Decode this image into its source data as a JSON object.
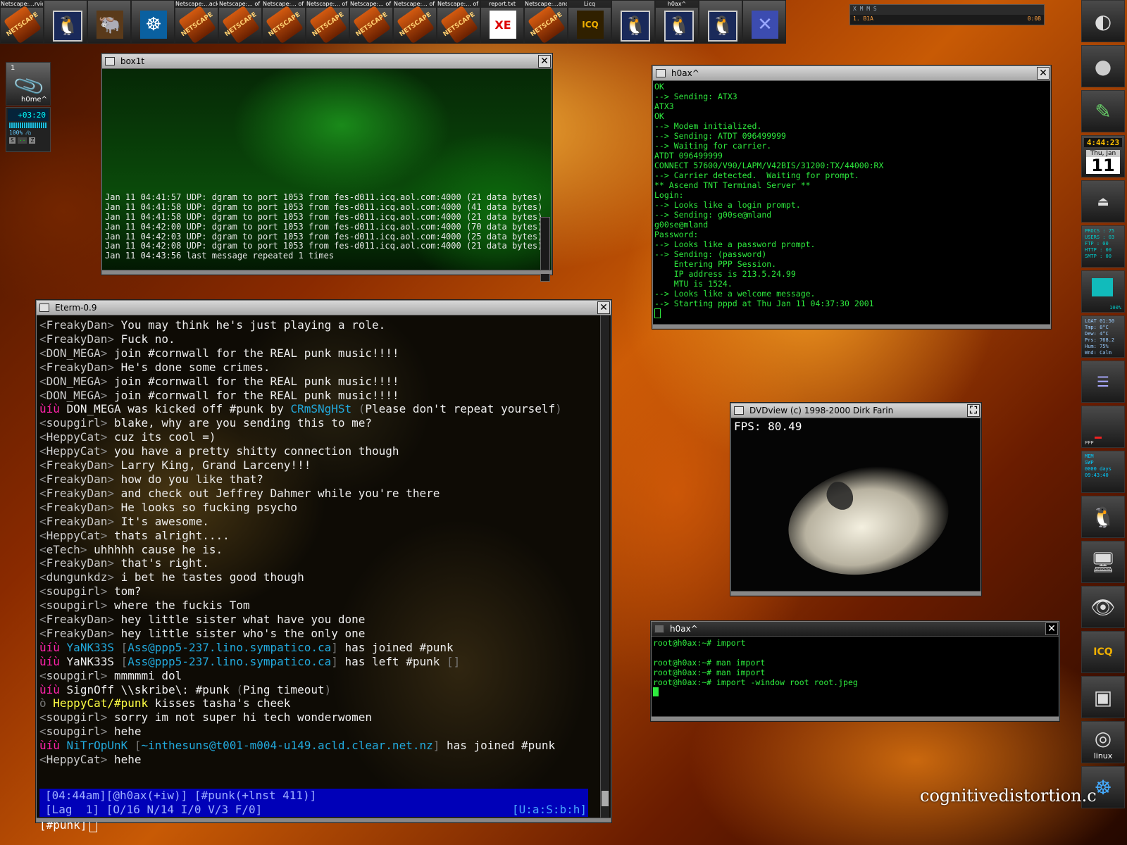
{
  "taskbar": {
    "items": [
      {
        "label": "Netscape:...rvice",
        "icon": "netscape-icon",
        "glyph": "NETSCAPE"
      },
      {
        "label": "",
        "icon": "tux-monitor-icon",
        "glyph": "🐧"
      },
      {
        "label": "",
        "icon": "gnu-icon",
        "glyph": "🐃"
      },
      {
        "label": "",
        "icon": "netscape-wheel-icon",
        "glyph": "☸"
      },
      {
        "label": "Netscape:...acks",
        "icon": "netscape-icon",
        "glyph": "NETSCAPE"
      },
      {
        "label": "Netscape:... of 7",
        "icon": "netscape-icon",
        "glyph": "NETSCAPE"
      },
      {
        "label": "Netscape:... of 7",
        "icon": "netscape-icon",
        "glyph": "NETSCAPE"
      },
      {
        "label": "Netscape:... of 7",
        "icon": "netscape-icon",
        "glyph": "NETSCAPE"
      },
      {
        "label": "Netscape:... of 7",
        "icon": "netscape-icon",
        "glyph": "NETSCAPE"
      },
      {
        "label": "Netscape:... of 7",
        "icon": "netscape-icon",
        "glyph": "NETSCAPE"
      },
      {
        "label": "Netscape:... of 7",
        "icon": "netscape-icon",
        "glyph": "NETSCAPE"
      },
      {
        "label": "report.txt",
        "icon": "xedit-icon",
        "glyph": "XE"
      },
      {
        "label": "Netscape:...ands",
        "icon": "netscape-icon",
        "glyph": "NETSCAPE"
      },
      {
        "label": "Licq",
        "icon": "icq-icon",
        "glyph": "ICQ"
      },
      {
        "label": "",
        "icon": "tux-monitor-icon",
        "glyph": "🐧"
      },
      {
        "label": "h0ax^",
        "icon": "tux-monitor-icon",
        "glyph": "🐧"
      },
      {
        "label": "",
        "icon": "tux-monitor-icon",
        "glyph": "🐧"
      },
      {
        "label": "",
        "icon": "xmms-x-icon",
        "glyph": "✕"
      }
    ]
  },
  "xmms": {
    "title": "X M M S",
    "track": "1. B1A",
    "time": "0:08"
  },
  "left_widgets": {
    "desk_number": "1",
    "desk_label": "h0me^",
    "timer": "+03:20",
    "percent": "100% ⁄⁄⌂"
  },
  "box1t": {
    "title": "box1t",
    "lines": [
      "Jan 11 04:41:57 UDP: dgram to port 1053 from fes-d011.icq.aol.com:4000 (21 data bytes)",
      "Jan 11 04:41:58 UDP: dgram to port 1053 from fes-d011.icq.aol.com:4000 (41 data bytes)",
      "Jan 11 04:41:58 UDP: dgram to port 1053 from fes-d011.icq.aol.com:4000 (21 data bytes)",
      "Jan 11 04:42:00 UDP: dgram to port 1053 from fes-d011.icq.aol.com:4000 (70 data bytes)",
      "Jan 11 04:42:03 UDP: dgram to port 1053 from fes-d011.icq.aol.com:4000 (25 data bytes)",
      "Jan 11 04:42:08 UDP: dgram to port 1053 from fes-d011.icq.aol.com:4000 (21 data bytes)",
      "Jan 11 04:43:56 last message repeated 1 times"
    ]
  },
  "h0ax_top": {
    "title": "h0ax^",
    "lines": [
      "OK",
      "--> Sending: ATX3",
      "ATX3",
      "OK",
      "--> Modem initialized.",
      "--> Sending: ATDT 096499999",
      "--> Waiting for carrier.",
      "ATDT 096499999",
      "CONNECT 57600/V90/LAPM/V42BIS/31200:TX/44000:RX",
      "--> Carrier detected.  Waiting for prompt.",
      "** Ascend TNT Terminal Server **",
      "Login:",
      "--> Looks like a login prompt.",
      "--> Sending: g00se@mland",
      "g00se@mland",
      "Password:",
      "--> Looks like a password prompt.",
      "--> Sending: (password)",
      "    Entering PPP Session.",
      "    IP address is 213.5.24.99",
      "    MTU is 1524.",
      "--> Looks like a welcome message.",
      "--> Starting pppd at Thu Jan 11 04:37:30 2001"
    ]
  },
  "eterm": {
    "title": "Eterm-0.9",
    "lines": [
      {
        "t": "msg",
        "nick": "FreakyDan",
        "text": "You may think he's just playing a role."
      },
      {
        "t": "msg",
        "nick": "FreakyDan",
        "text": "Fuck no."
      },
      {
        "t": "msg",
        "nick": "DON_MEGA",
        "text": "join #cornwall for the REAL punk music!!!!"
      },
      {
        "t": "msg",
        "nick": "FreakyDan",
        "text": "He's done some crimes."
      },
      {
        "t": "msg",
        "nick": "DON_MEGA",
        "text": "join #cornwall for the REAL punk music!!!!"
      },
      {
        "t": "msg",
        "nick": "DON_MEGA",
        "text": "join #cornwall for the REAL punk music!!!!"
      },
      {
        "t": "kick",
        "prefix": "ùíù",
        "a": "DON_MEGA was kicked off #punk by ",
        "b": "CRmSNgHSt",
        "c": "Please don't repeat yourself"
      },
      {
        "t": "msg",
        "nick": "soupgirl",
        "text": "blake, why are you sending this to me?"
      },
      {
        "t": "msg",
        "nick": "HeppyCat",
        "text": "cuz its cool =)"
      },
      {
        "t": "msg",
        "nick": "HeppyCat",
        "text": "you have a pretty shitty connection though"
      },
      {
        "t": "msg",
        "nick": "FreakyDan",
        "text": "Larry King, Grand Larceny!!!"
      },
      {
        "t": "msg",
        "nick": "FreakyDan",
        "text": "how do you like that?"
      },
      {
        "t": "msg",
        "nick": "FreakyDan",
        "text": "and check out Jeffrey Dahmer while you're there"
      },
      {
        "t": "msg",
        "nick": "FreakyDan",
        "text": "He looks so fucking psycho"
      },
      {
        "t": "msg",
        "nick": "FreakyDan",
        "text": "It's awesome."
      },
      {
        "t": "msg",
        "nick": "HeppyCat",
        "text": "thats alright...."
      },
      {
        "t": "msg",
        "nick": "eTech",
        "text": "uhhhhh cause he is."
      },
      {
        "t": "msg",
        "nick": "FreakyDan",
        "text": "that's right."
      },
      {
        "t": "msg",
        "nick": "dungunkdz",
        "text": "i bet he tastes good though"
      },
      {
        "t": "msg",
        "nick": "soupgirl",
        "text": "tom?"
      },
      {
        "t": "msg",
        "nick": "soupgirl",
        "text": "where the fuckis Tom"
      },
      {
        "t": "msg",
        "nick": "FreakyDan",
        "text": "hey little sister what have you done"
      },
      {
        "t": "msg",
        "nick": "FreakyDan",
        "text": "hey little sister who's the only one"
      },
      {
        "t": "join",
        "prefix": "ùíù",
        "who": "YaNK33S",
        "host": "Ass@ppp5-237.lino.sympatico.ca",
        "text": "has joined #punk"
      },
      {
        "t": "part",
        "prefix": "ùíù",
        "who": "YaNK33S",
        "host": "Ass@ppp5-237.lino.sympatico.ca",
        "text": "has left #punk",
        "tail": "[]"
      },
      {
        "t": "msg",
        "nick": "soupgirl",
        "text": "mmmmmi dol"
      },
      {
        "t": "quit",
        "prefix": "ùíù",
        "text": "SignOff \\\\skribe\\: #punk",
        "reason": "Ping timeout"
      },
      {
        "t": "action",
        "prefix": "ò",
        "who": "HeppyCat/#punk",
        "text": "kisses tasha's cheek"
      },
      {
        "t": "msg",
        "nick": "soupgirl",
        "text": "sorry im not super hi tech wonderwomen"
      },
      {
        "t": "msg",
        "nick": "soupgirl",
        "text": "hehe"
      },
      {
        "t": "join",
        "prefix": "ùíù",
        "who": "NiTrOpUnK",
        "host": "~inthesuns@t001-m004-u149.acld.clear.net.nz",
        "text": "has joined #punk"
      },
      {
        "t": "msg",
        "nick": "HeppyCat",
        "text": "hehe"
      }
    ],
    "status_line1": "[04:44am][@h0ax(+iw)] [#punk(+lnst 411)]",
    "status_line2": "[Lag  1] [O/16 N/14 I/0 V/3 F/0]",
    "status_right": "[U:a:S:b:h]",
    "prompt": "[#punk]"
  },
  "dvd": {
    "title": "DVDview (c) 1998-2000 Dirk Farin",
    "fps": "FPS: 80.49"
  },
  "h0ax_bottom": {
    "title": "h0ax^",
    "lines": [
      "root@h0ax:~# import",
      "",
      "root@h0ax:~# man import",
      "root@h0ax:~# man import",
      "root@h0ax:~# import -window root root.jpeg"
    ]
  },
  "dock": {
    "clock_time": "4:44:23",
    "clock_dow": "Thu, Jan",
    "clock_day": "11",
    "procs": [
      "PROCS : 75",
      "USERS : 03",
      "FTP   : 00",
      "HTTP  : 00",
      "SMTP  : 00"
    ],
    "volume": "100%",
    "weather": [
      "LGAT 01:50",
      "Tmp: 8°C",
      "Dew: 4°C",
      "Prs: 768.2",
      "Hum: 75%",
      "Wnd: Calm"
    ],
    "ppp": "PPP",
    "mem": [
      "MEM",
      "SWP",
      "0000 days",
      "09:43:40"
    ],
    "linux_label": "linux"
  },
  "watermark": "cognitivedistortion.c"
}
